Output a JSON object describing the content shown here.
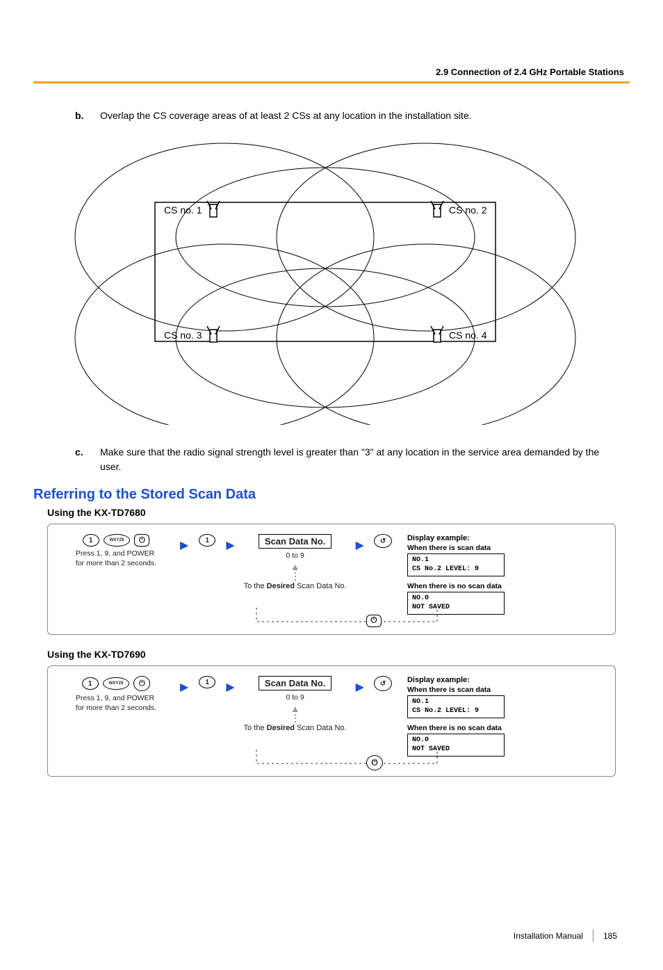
{
  "header": {
    "section_title": "2.9 Connection of 2.4 GHz Portable Stations"
  },
  "steps": {
    "b": {
      "marker": "b.",
      "text": "Overlap the CS coverage areas of at least 2 CSs at any location in the installation site."
    },
    "c": {
      "marker": "c.",
      "text": "Make sure that the radio signal strength level is greater than \"3\" at any location in the service area demanded by the user."
    }
  },
  "diagram": {
    "labels": {
      "cs1": "CS no. 1",
      "cs2": "CS no. 2",
      "cs3": "CS no. 3",
      "cs4": "CS no. 4"
    }
  },
  "section_title": "Referring to the Stored Scan Data",
  "procedures": [
    {
      "model_heading": "Using the KX-TD7680",
      "power_shape": "square",
      "step1": {
        "btn1": "1",
        "btn2": "WXYZ9",
        "power_label": "⏻",
        "note": "Press 1, 9, and POWER\nfor more than 2 seconds."
      },
      "step2": {
        "btn": "1"
      },
      "step3": {
        "label": "Scan Data No.",
        "range": "0 to 9",
        "desired_prefix": "To the ",
        "desired_bold": "Desired",
        "desired_suffix": " Scan Data No."
      },
      "join_icon": "⏻",
      "display": {
        "heading": "Display example:",
        "when_yes": "When there is scan data",
        "yes_lines": "NO.1\nCS No.2 LEVEL: 9",
        "when_no": "When there is no scan data",
        "no_lines": "NO.0\nNOT SAVED"
      }
    },
    {
      "model_heading": "Using the KX-TD7690",
      "power_shape": "round",
      "step1": {
        "btn1": "1",
        "btn2": "WXYZ9",
        "power_label": "⏻",
        "note": "Press 1, 9, and POWER\nfor more than 2 seconds."
      },
      "step2": {
        "btn": "1"
      },
      "step3": {
        "label": "Scan Data No.",
        "range": "0 to 9",
        "desired_prefix": "To the ",
        "desired_bold": "Desired",
        "desired_suffix": " Scan Data No."
      },
      "join_icon": "⏻",
      "display": {
        "heading": "Display example:",
        "when_yes": "When there is scan data",
        "yes_lines": "NO.1\nCS No.2 LEVEL: 9",
        "when_no": "When there is no scan data",
        "no_lines": "NO.0\nNOT SAVED"
      }
    }
  ],
  "footer": {
    "manual": "Installation Manual",
    "page": "185"
  }
}
